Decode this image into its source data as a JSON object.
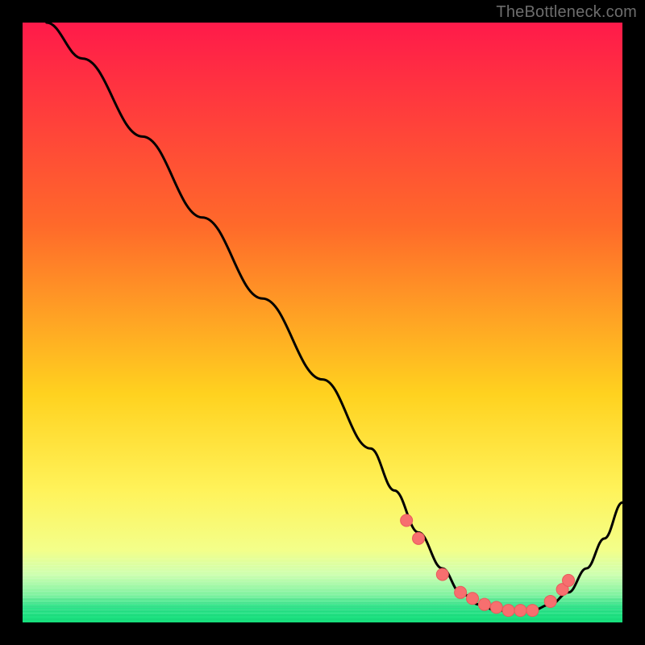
{
  "attribution": "TheBottleneck.com",
  "colors": {
    "frame": "#000000",
    "curve": "#000000",
    "marker_fill": "#f76f6f",
    "marker_stroke": "#e85b5b",
    "grad_top": "#ff1a4a",
    "grad_mid1": "#ff9a2a",
    "grad_mid2": "#ffe92e",
    "grad_low1": "#f6ff7a",
    "grad_low2": "#c7ffb0",
    "grad_bottom": "#16e07c"
  },
  "chart_data": {
    "type": "line",
    "title": "",
    "xlabel": "",
    "ylabel": "",
    "xlim": [
      0,
      100
    ],
    "ylim": [
      0,
      100
    ],
    "curve": {
      "x": [
        4,
        10,
        20,
        30,
        40,
        50,
        58,
        62,
        66,
        70,
        73,
        76,
        79,
        82,
        85,
        88,
        91,
        94,
        97,
        100
      ],
      "y": [
        100,
        94,
        81,
        67.5,
        54,
        40.5,
        29,
        22,
        15,
        9,
        5,
        3,
        2,
        2,
        2,
        3,
        5,
        9,
        14,
        20
      ]
    },
    "markers": {
      "x": [
        64,
        66,
        70,
        73,
        75,
        77,
        79,
        81,
        83,
        85,
        88,
        90,
        91
      ],
      "y": [
        17,
        14,
        8,
        5,
        4,
        3,
        2.5,
        2,
        2,
        2,
        3.5,
        5.5,
        7
      ]
    },
    "gradient_bands": [
      {
        "y0": 100,
        "y1": 18,
        "from": "grad_top",
        "to": "grad_mid2"
      },
      {
        "y0": 18,
        "y1": 9,
        "from": "grad_mid2",
        "to": "grad_low1"
      },
      {
        "y0": 9,
        "y1": 5,
        "from": "grad_low1",
        "to": "grad_low2"
      },
      {
        "y0": 5,
        "y1": 0,
        "from": "grad_low2",
        "to": "grad_bottom"
      }
    ]
  }
}
